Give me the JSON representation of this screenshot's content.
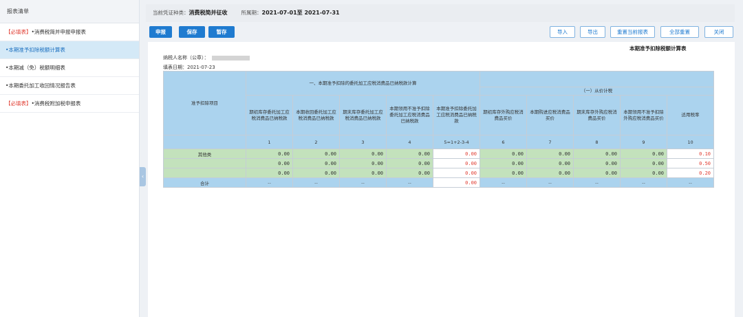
{
  "sidebar": {
    "header": "报表清单",
    "items": [
      {
        "tag": "【必填表】",
        "label": "•消费税简并申报申报表",
        "active": false
      },
      {
        "tag": "",
        "label": "•本期准予扣除税额计算表",
        "active": true
      },
      {
        "tag": "",
        "label": "•本期减（免）税额明细表",
        "active": false
      },
      {
        "tag": "",
        "label": "•本期委托加工收回情况报告表",
        "active": false
      },
      {
        "tag": "【必填表】",
        "label": "•消费税附加税申报表",
        "active": false
      }
    ]
  },
  "infobar": {
    "type_label": "当前凭证种类：",
    "type_value": "消费税简并征收",
    "period_label": "所属期：",
    "period_value": "2021-07-01至 2021-07-31"
  },
  "toolbar": {
    "declare": "申报",
    "save": "保存",
    "draft": "暂存",
    "import": "导入",
    "export": "导出",
    "reset_current": "重置当前报表",
    "reset_all": "全部重置",
    "close": "关闭"
  },
  "report": {
    "title": "本期准予扣除税额计算表",
    "taxpayer_label": "纳税人名称（公章）：",
    "fill_date_label": "填表日期：",
    "fill_date": "2021-07-23"
  },
  "table": {
    "row_header": "准予扣除项目",
    "group1": "一、本期准予扣除的委托加工应税消费品已纳税款计算",
    "group2": "（一）从价计税",
    "columns": [
      "期初库存委托加工应税消费品已纳税款",
      "本期收回委托加工应税消费品已纳税款",
      "期末库存委托加工应税消费品已纳税款",
      "本期领用不准予扣除委托加工应税消费品已纳税款",
      "本期准予扣除委托加工应税消费品已纳税款",
      "期初库存外购应税消费品买价",
      "本期购进应税消费品买价",
      "期末库存外购应税消费品买价",
      "本期领用不准予扣除外购应税消费品买价",
      "适用税率"
    ],
    "col_numbers": [
      "1",
      "2",
      "3",
      "4",
      "5=1+2-3-4",
      "6",
      "7",
      "8",
      "9",
      "10"
    ],
    "rows": [
      {
        "label": "其他类",
        "values": [
          "0.00",
          "0.00",
          "0.00",
          "0.00",
          "0.00",
          "0.00",
          "0.00",
          "0.00",
          "0.00",
          "0.10"
        ]
      },
      {
        "label": "",
        "values": [
          "0.00",
          "0.00",
          "0.00",
          "0.00",
          "0.00",
          "0.00",
          "0.00",
          "0.00",
          "0.00",
          "0.50"
        ]
      },
      {
        "label": "",
        "values": [
          "0.00",
          "0.00",
          "0.00",
          "0.00",
          "0.00",
          "0.00",
          "0.00",
          "0.00",
          "0.00",
          "0.20"
        ]
      }
    ],
    "total": {
      "label": "合计",
      "values": [
        "--",
        "--",
        "--",
        "--",
        "0.00",
        "--",
        "--",
        "--",
        "--",
        "--"
      ]
    }
  },
  "colors": {
    "primary": "#1f7bd0",
    "header_blue": "#abd3ee",
    "row_green": "#c3e2bc",
    "accent_red": "#e03c31"
  }
}
